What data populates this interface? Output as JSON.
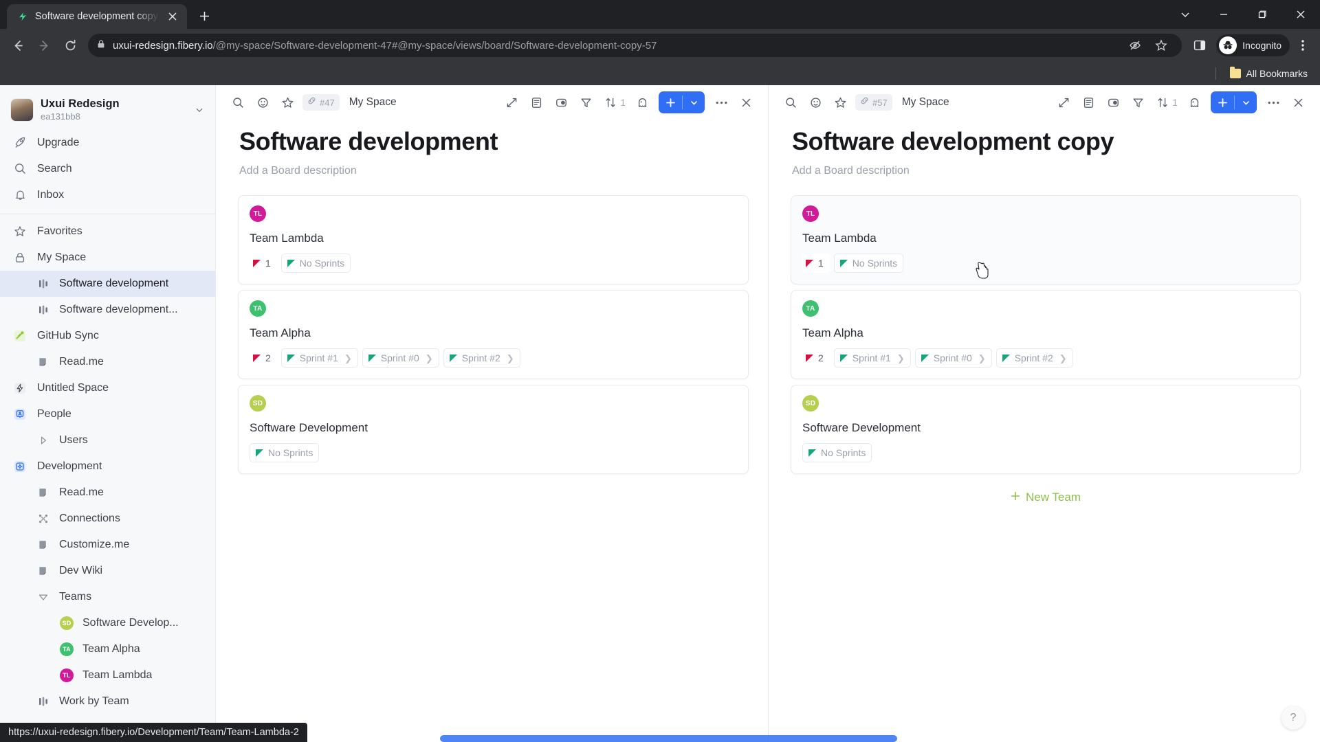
{
  "browser": {
    "tab": {
      "title": "Software development copy | Fib",
      "favicon": "fibery-logo-icon",
      "close": "×"
    },
    "new_tab_tooltip": "+",
    "window_controls": {
      "expand": "⌄",
      "minimize": "—",
      "maximize": "❐",
      "close": "✕"
    },
    "nav": {
      "back": "←",
      "forward": "→",
      "reload": "⟳"
    },
    "omnibox": {
      "lock": "site-information-icon",
      "url_host": "uxui-redesign.fibery.io",
      "url_path": "/@my-space/Software-development-47#@my-space/views/board/Software-development-copy-57",
      "full_url": "uxui-redesign.fibery.io/@my-space/Software-development-47#@my-space/views/board/Software-development-copy-57",
      "tracking_protection": "eye-slash-icon",
      "bookmark": "star-icon"
    },
    "side_panel": "side-panel-icon",
    "profile": {
      "label": "Incognito",
      "icon": "incognito-avatar-icon"
    },
    "menu": "three-dot-menu-icon",
    "bookmarks": {
      "all_bookmarks": "All Bookmarks"
    },
    "status_url": "https://uxui-redesign.fibery.io/Development/Team/Team-Lambda-2"
  },
  "sidebar": {
    "workspace": {
      "name": "Uxui Redesign",
      "id": "ea131bb8",
      "chevron": "⌄"
    },
    "top_items": [
      {
        "label": "Upgrade",
        "icon": "rocket-icon"
      },
      {
        "label": "Search",
        "icon": "search-icon"
      },
      {
        "label": "Inbox",
        "icon": "bell-icon"
      }
    ],
    "items": [
      {
        "label": "Favorites",
        "icon": "star-icon",
        "level": 0,
        "active": false
      },
      {
        "label": "My Space",
        "icon": "lock-icon",
        "level": 0,
        "active": false
      },
      {
        "label": "Software development",
        "icon": "board-icon",
        "level": 1,
        "active": true
      },
      {
        "label": "Software development...",
        "icon": "board-icon",
        "level": 1,
        "active": false
      },
      {
        "label": "GitHub Sync",
        "icon": "github-sync-icon",
        "level": 0,
        "active": false
      },
      {
        "label": "Read.me",
        "icon": "document-icon",
        "level": 1,
        "active": false
      },
      {
        "label": "Untitled Space",
        "icon": "lightning-icon",
        "level": 0,
        "active": false
      },
      {
        "label": "People",
        "icon": "people-icon",
        "level": 0,
        "active": false
      },
      {
        "label": "Users",
        "icon": "triangle-right-icon",
        "level": 1,
        "active": false
      },
      {
        "label": "Development",
        "icon": "development-icon",
        "level": 0,
        "active": false
      },
      {
        "label": "Read.me",
        "icon": "document-icon",
        "level": 1,
        "active": false
      },
      {
        "label": "Connections",
        "icon": "connections-icon",
        "level": 1,
        "active": false
      },
      {
        "label": "Customize.me",
        "icon": "document-icon",
        "level": 1,
        "active": false
      },
      {
        "label": "Dev Wiki",
        "icon": "document-icon",
        "level": 1,
        "active": false
      },
      {
        "label": "Teams",
        "icon": "collapse-triangle-icon",
        "level": 1,
        "active": false
      },
      {
        "label": "Software Develop...",
        "icon": "team-avatar",
        "level": 2,
        "active": false,
        "initials": "SD",
        "color": "#b6cf4e"
      },
      {
        "label": "Team Alpha",
        "icon": "team-avatar",
        "level": 2,
        "active": false,
        "initials": "TA",
        "color": "#3ec16e"
      },
      {
        "label": "Team Lambda",
        "icon": "team-avatar",
        "level": 2,
        "active": false,
        "initials": "TL",
        "color": "#d2199a"
      },
      {
        "label": "Work by Team",
        "icon": "board-icon",
        "level": 1,
        "active": false
      }
    ]
  },
  "panels": [
    {
      "id": "left-panel",
      "toolbar": {
        "search": "search-icon",
        "emoji": "emoji-icon",
        "star": "star-icon",
        "link_badge": "#47",
        "space": "My Space",
        "expand": "expand-icon",
        "document": "document-view-icon",
        "view": "view-toggle-icon",
        "filter": "filter-icon",
        "sort": "sort-icon",
        "sort_count": "1",
        "ghost": "ghost-icon",
        "add": "+",
        "add_caret": "⌄",
        "more": "···",
        "close": "✕"
      },
      "title": "Software development",
      "description": "Add a Board description",
      "show_new_team": false,
      "cards": [
        {
          "initials": "TL",
          "color": "#d2199a",
          "title": "Team Lambda",
          "chips": [
            {
              "kind": "count",
              "icon": "red-triangle-icon",
              "text": "1"
            },
            {
              "kind": "tag",
              "icon": "green-triangle-icon",
              "text": "No Sprints"
            }
          ]
        },
        {
          "initials": "TA",
          "color": "#3ec16e",
          "title": "Team Alpha",
          "chips": [
            {
              "kind": "count",
              "icon": "red-triangle-icon",
              "text": "2"
            },
            {
              "kind": "link",
              "icon": "green-triangle-icon",
              "text": "Sprint #1"
            },
            {
              "kind": "link",
              "icon": "green-triangle-icon",
              "text": "Sprint #0"
            },
            {
              "kind": "link",
              "icon": "green-triangle-icon",
              "text": "Sprint #2"
            }
          ]
        },
        {
          "initials": "SD",
          "color": "#b6cf4e",
          "title": "Software Development",
          "chips": [
            {
              "kind": "tag",
              "icon": "green-triangle-icon",
              "text": "No Sprints"
            }
          ]
        }
      ]
    },
    {
      "id": "right-panel",
      "toolbar": {
        "search": "search-icon",
        "emoji": "emoji-icon",
        "star": "star-icon",
        "link_badge": "#57",
        "space": "My Space",
        "expand": "expand-icon",
        "document": "document-view-icon",
        "view": "view-toggle-icon",
        "filter": "filter-icon",
        "sort": "sort-icon",
        "sort_count": "1",
        "ghost": "ghost-icon",
        "add": "+",
        "add_caret": "⌄",
        "more": "···",
        "close": "✕"
      },
      "title": "Software development copy",
      "description": "Add a Board description",
      "show_new_team": true,
      "new_team_label": "New Team",
      "new_team_plus": "+",
      "cards": [
        {
          "initials": "TL",
          "color": "#d2199a",
          "title": "Team Lambda",
          "hovered": true,
          "chips": [
            {
              "kind": "count",
              "icon": "red-triangle-icon",
              "text": "1"
            },
            {
              "kind": "tag",
              "icon": "green-triangle-icon",
              "text": "No Sprints"
            }
          ]
        },
        {
          "initials": "TA",
          "color": "#3ec16e",
          "title": "Team Alpha",
          "chips": [
            {
              "kind": "count",
              "icon": "red-triangle-icon",
              "text": "2"
            },
            {
              "kind": "link",
              "icon": "green-triangle-icon",
              "text": "Sprint #1"
            },
            {
              "kind": "link",
              "icon": "green-triangle-icon",
              "text": "Sprint #0"
            },
            {
              "kind": "link",
              "icon": "green-triangle-icon",
              "text": "Sprint #2"
            }
          ]
        },
        {
          "initials": "SD",
          "color": "#b6cf4e",
          "title": "Software Development",
          "chips": [
            {
              "kind": "tag",
              "icon": "green-triangle-icon",
              "text": "No Sprints"
            }
          ]
        }
      ]
    }
  ],
  "help_button": "?",
  "colors": {
    "accent_blue": "#2f6ef5",
    "sidebar_bg": "#f7f8fa",
    "active_nav": "#e3e8f7",
    "red_triangle": "#d4123f",
    "green_triangle": "#17a67c",
    "new_team_green": "#8fbf4a",
    "chrome_dark": "#35363a"
  }
}
